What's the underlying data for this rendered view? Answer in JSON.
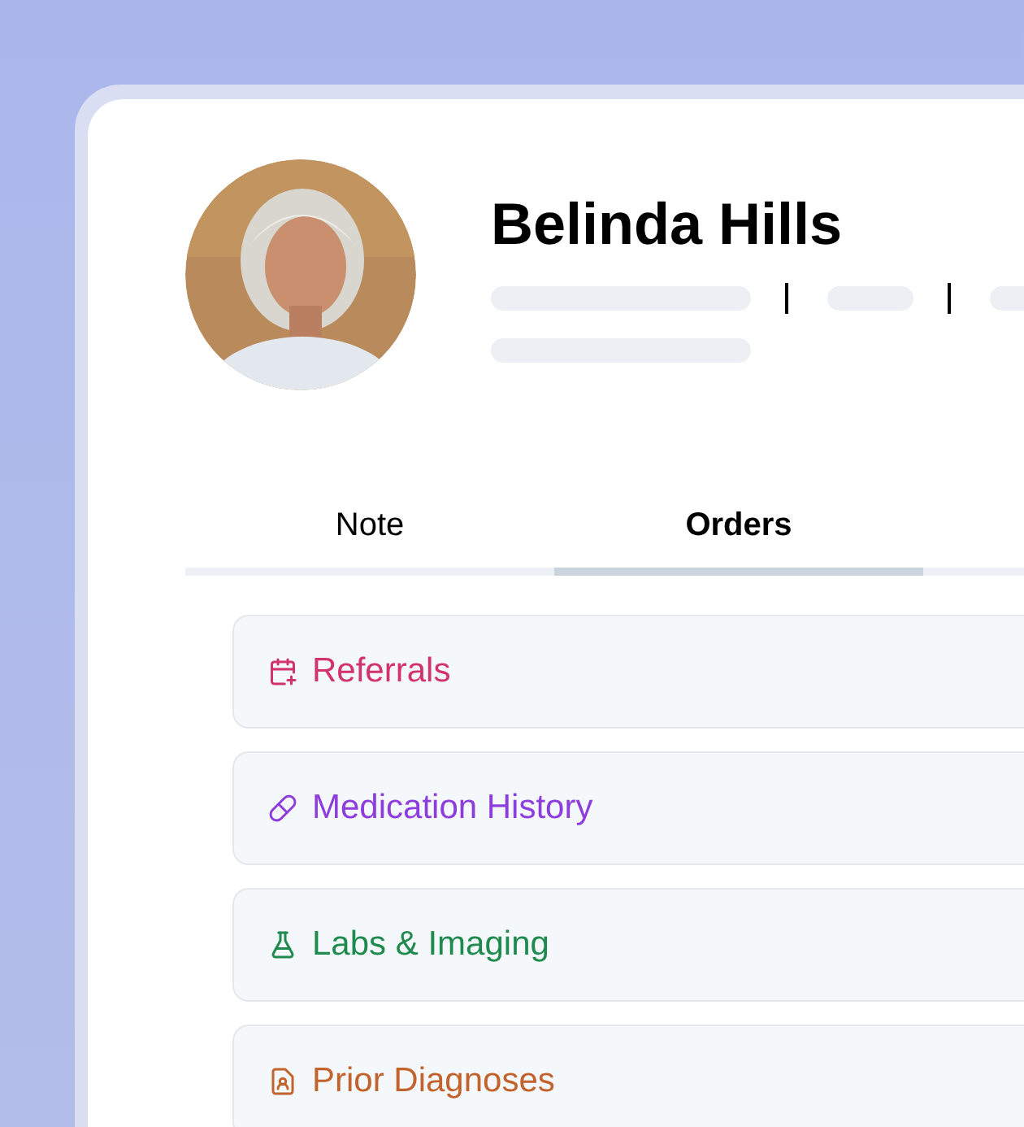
{
  "profile": {
    "name": "Belinda Hills"
  },
  "tabs": [
    {
      "label": "Note",
      "selected": false
    },
    {
      "label": "Orders",
      "selected": true
    }
  ],
  "sections": [
    {
      "kind": "referral",
      "label": "Referrals",
      "color": "#d2336f"
    },
    {
      "kind": "medication",
      "label": "Medication History",
      "color": "#8d3ddb"
    },
    {
      "kind": "lab",
      "label": "Labs & Imaging",
      "color": "#1f8a4e"
    },
    {
      "kind": "diagnosis",
      "label": "Prior Diagnoses",
      "color": "#c2622c"
    }
  ]
}
